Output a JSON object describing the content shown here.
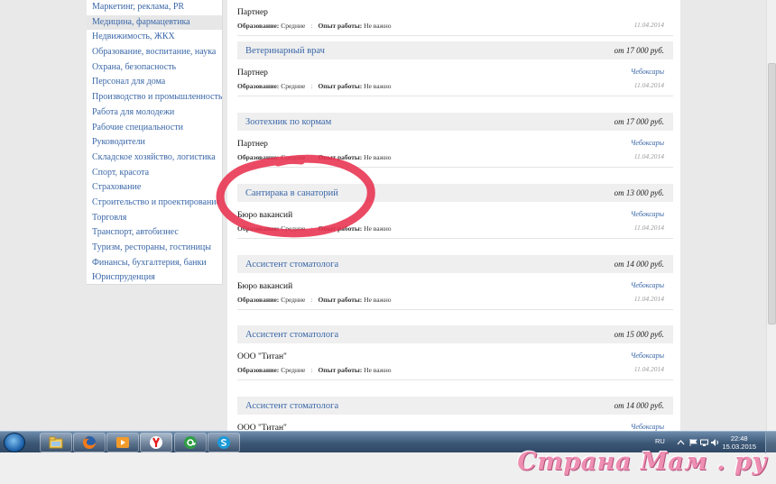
{
  "categories": [
    {
      "label": "Маркетинг, реклама, PR"
    },
    {
      "label": "Медицина, фармацевтика",
      "active": true
    },
    {
      "label": "Недвижимость, ЖКХ"
    },
    {
      "label": "Образование, воспитание, наука"
    },
    {
      "label": "Охрана, безопасность"
    },
    {
      "label": "Персонал для дома"
    },
    {
      "label": "Производство и промышленность"
    },
    {
      "label": "Работа для молодежи"
    },
    {
      "label": "Рабочие специальности"
    },
    {
      "label": "Руководители"
    },
    {
      "label": "Складское хозяйство, логистика"
    },
    {
      "label": "Спорт, красота"
    },
    {
      "label": "Страхование"
    },
    {
      "label": "Строительство и проектирование"
    },
    {
      "label": "Торговля"
    },
    {
      "label": "Транспорт, автобизнес"
    },
    {
      "label": "Туризм, рестораны, гостиницы"
    },
    {
      "label": "Финансы, бухгалтерия, банки"
    },
    {
      "label": "Юриспруденция"
    }
  ],
  "labels": {
    "education": "Образование:",
    "experience": "Опыт работы:",
    "separator": ":"
  },
  "jobs": [
    {
      "title": "",
      "salary": "",
      "company": "Партнер",
      "city": "",
      "education": "Средние",
      "experience": "Не важно",
      "date": "11.04.2014"
    },
    {
      "title": "Ветеринарный врач",
      "salary": "от 17 000 руб.",
      "company": "Партнер",
      "city": "Чебоксары",
      "education": "Средние",
      "experience": "Не важно",
      "date": "11.04.2014"
    },
    {
      "title": "Зоотехник по кормам",
      "salary": "от 17 000 руб.",
      "company": "Партнер",
      "city": "Чебоксары",
      "education": "Средние",
      "experience": "Не важно",
      "date": "11.04.2014"
    },
    {
      "title": "Сантирака в санаторий",
      "salary": "от 13 000 руб.",
      "company": "Бюро вакансий",
      "city": "Чебоксары",
      "education": "Средние",
      "experience": "Не важно",
      "date": "11.04.2014"
    },
    {
      "title": "Ассистент стоматолога",
      "salary": "от 14 000 руб.",
      "company": "Бюро вакансий",
      "city": "Чебоксары",
      "education": "Средние",
      "experience": "Не важно",
      "date": "11.04.2014"
    },
    {
      "title": "Ассистент стоматолога",
      "salary": "от 15 000 руб.",
      "company": "ООО \"Титан\"",
      "city": "Чебоксары",
      "education": "Средние",
      "experience": "Не важно",
      "date": "11.04.2014"
    },
    {
      "title": "Ассистент стоматолога",
      "salary": "от 14 000 руб.",
      "company": "ООО \"Титан\"",
      "city": "Чебоксары",
      "education": "",
      "experience": "",
      "date": ""
    }
  ],
  "taskbar": {
    "apps": [
      {
        "icon": "file-explorer-icon"
      },
      {
        "icon": "firefox-icon"
      },
      {
        "icon": "media-player-icon"
      },
      {
        "icon": "yandex-browser-icon"
      },
      {
        "icon": "mail-agent-icon"
      },
      {
        "icon": "skype-icon"
      }
    ],
    "language": "RU",
    "time": "22:48",
    "date": "15.03.2015"
  },
  "watermark": "Страна Мам . ру",
  "colors": {
    "link": "#3a67a8",
    "highlight_circle": "#e8314f",
    "watermark": "#ee8fb2"
  }
}
